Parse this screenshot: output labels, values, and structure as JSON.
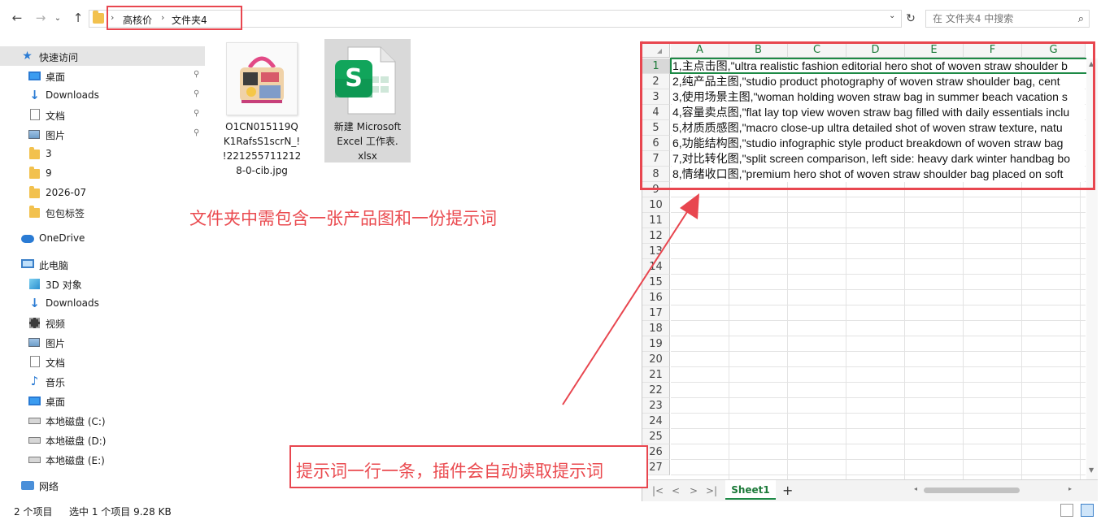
{
  "address": {
    "crumbs": [
      "高核价",
      "文件夹4"
    ],
    "search_placeholder": "在 文件夹4 中搜索"
  },
  "nav": {
    "back": "←",
    "forward": "→",
    "caret": "⌄",
    "up": "↑",
    "refresh": "↻",
    "search_icon": "⌕",
    "pin": "📌"
  },
  "sidebar": {
    "items": [
      {
        "label": "快速访问",
        "icon": "star-icon"
      },
      {
        "label": "桌面",
        "icon": "desktop-icon"
      },
      {
        "label": "Downloads",
        "icon": "download-arrow-icon"
      },
      {
        "label": "文档",
        "icon": "document-icon"
      },
      {
        "label": "图片",
        "icon": "pictures-icon"
      },
      {
        "label": "3",
        "icon": "folder-icon"
      },
      {
        "label": "9",
        "icon": "folder-icon"
      },
      {
        "label": "2026-07",
        "icon": "folder-icon"
      },
      {
        "label": "包包标签",
        "icon": "folder-icon"
      },
      {
        "label": "OneDrive",
        "icon": "cloud-icon"
      },
      {
        "label": "此电脑",
        "icon": "computer-icon"
      },
      {
        "label": "3D 对象",
        "icon": "cube-icon"
      },
      {
        "label": "Downloads",
        "icon": "download-arrow-icon"
      },
      {
        "label": "视频",
        "icon": "video-icon"
      },
      {
        "label": "图片",
        "icon": "pictures-icon"
      },
      {
        "label": "文档",
        "icon": "document-icon"
      },
      {
        "label": "音乐",
        "icon": "music-note-icon"
      },
      {
        "label": "桌面",
        "icon": "desktop-icon"
      },
      {
        "label": "本地磁盘 (C:)",
        "icon": "drive-icon"
      },
      {
        "label": "本地磁盘 (D:)",
        "icon": "drive-icon"
      },
      {
        "label": "本地磁盘 (E:)",
        "icon": "drive-icon"
      },
      {
        "label": "网络",
        "icon": "network-icon"
      }
    ]
  },
  "files": [
    {
      "name_lines": [
        "O1CN015119Q",
        "K1RafsS1scrN_!",
        "!221255711212",
        "8-0-cib.jpg"
      ],
      "type": "image"
    },
    {
      "name_lines": [
        "新建 Microsoft",
        "Excel 工作表.",
        "xlsx"
      ],
      "type": "spreadsheet"
    }
  ],
  "annotations": {
    "hint1": "文件夹中需包含一张产品图和一份提示词",
    "hint2": "提示词一行一条，插件会自动读取提示词"
  },
  "excel": {
    "columns": [
      "A",
      "B",
      "C",
      "D",
      "E",
      "F",
      "G"
    ],
    "rows": [
      "1",
      "2",
      "3",
      "4",
      "5",
      "6",
      "7",
      "8",
      "9",
      "10",
      "11",
      "12",
      "13",
      "14",
      "15",
      "16",
      "17",
      "18",
      "19",
      "20",
      "21",
      "22",
      "23",
      "24",
      "25",
      "26",
      "27"
    ],
    "cells": [
      "1,主点击图,\"ultra realistic fashion editorial hero shot of woven straw shoulder b",
      "2,纯产品主图,\"studio product photography of woven straw shoulder bag, cent",
      "3,使用场景主图,\"woman holding woven straw bag in summer beach vacation s",
      "4,容量卖点图,\"flat lay top view woven straw bag filled with daily essentials inclu",
      "5,材质质感图,\"macro close-up ultra detailed shot of woven straw texture, natu",
      "6,功能结构图,\"studio infographic style product breakdown of woven straw bag",
      "7,对比转化图,\"split screen comparison, left side: heavy dark winter handbag bo",
      "8,情绪收口图,\"premium hero shot of woven straw shoulder bag placed on soft"
    ],
    "sheet_tab": "Sheet1",
    "add_sheet": "+",
    "nav_first": "|<",
    "nav_prev": "<",
    "nav_next": ">",
    "nav_last": ">|"
  },
  "status": {
    "count": "2 个项目",
    "selected": "选中 1 个项目  9.28 KB"
  },
  "colors": {
    "annotation": "#e8464f",
    "excel_green": "#1d8a46",
    "folder": "#f2c14e"
  }
}
